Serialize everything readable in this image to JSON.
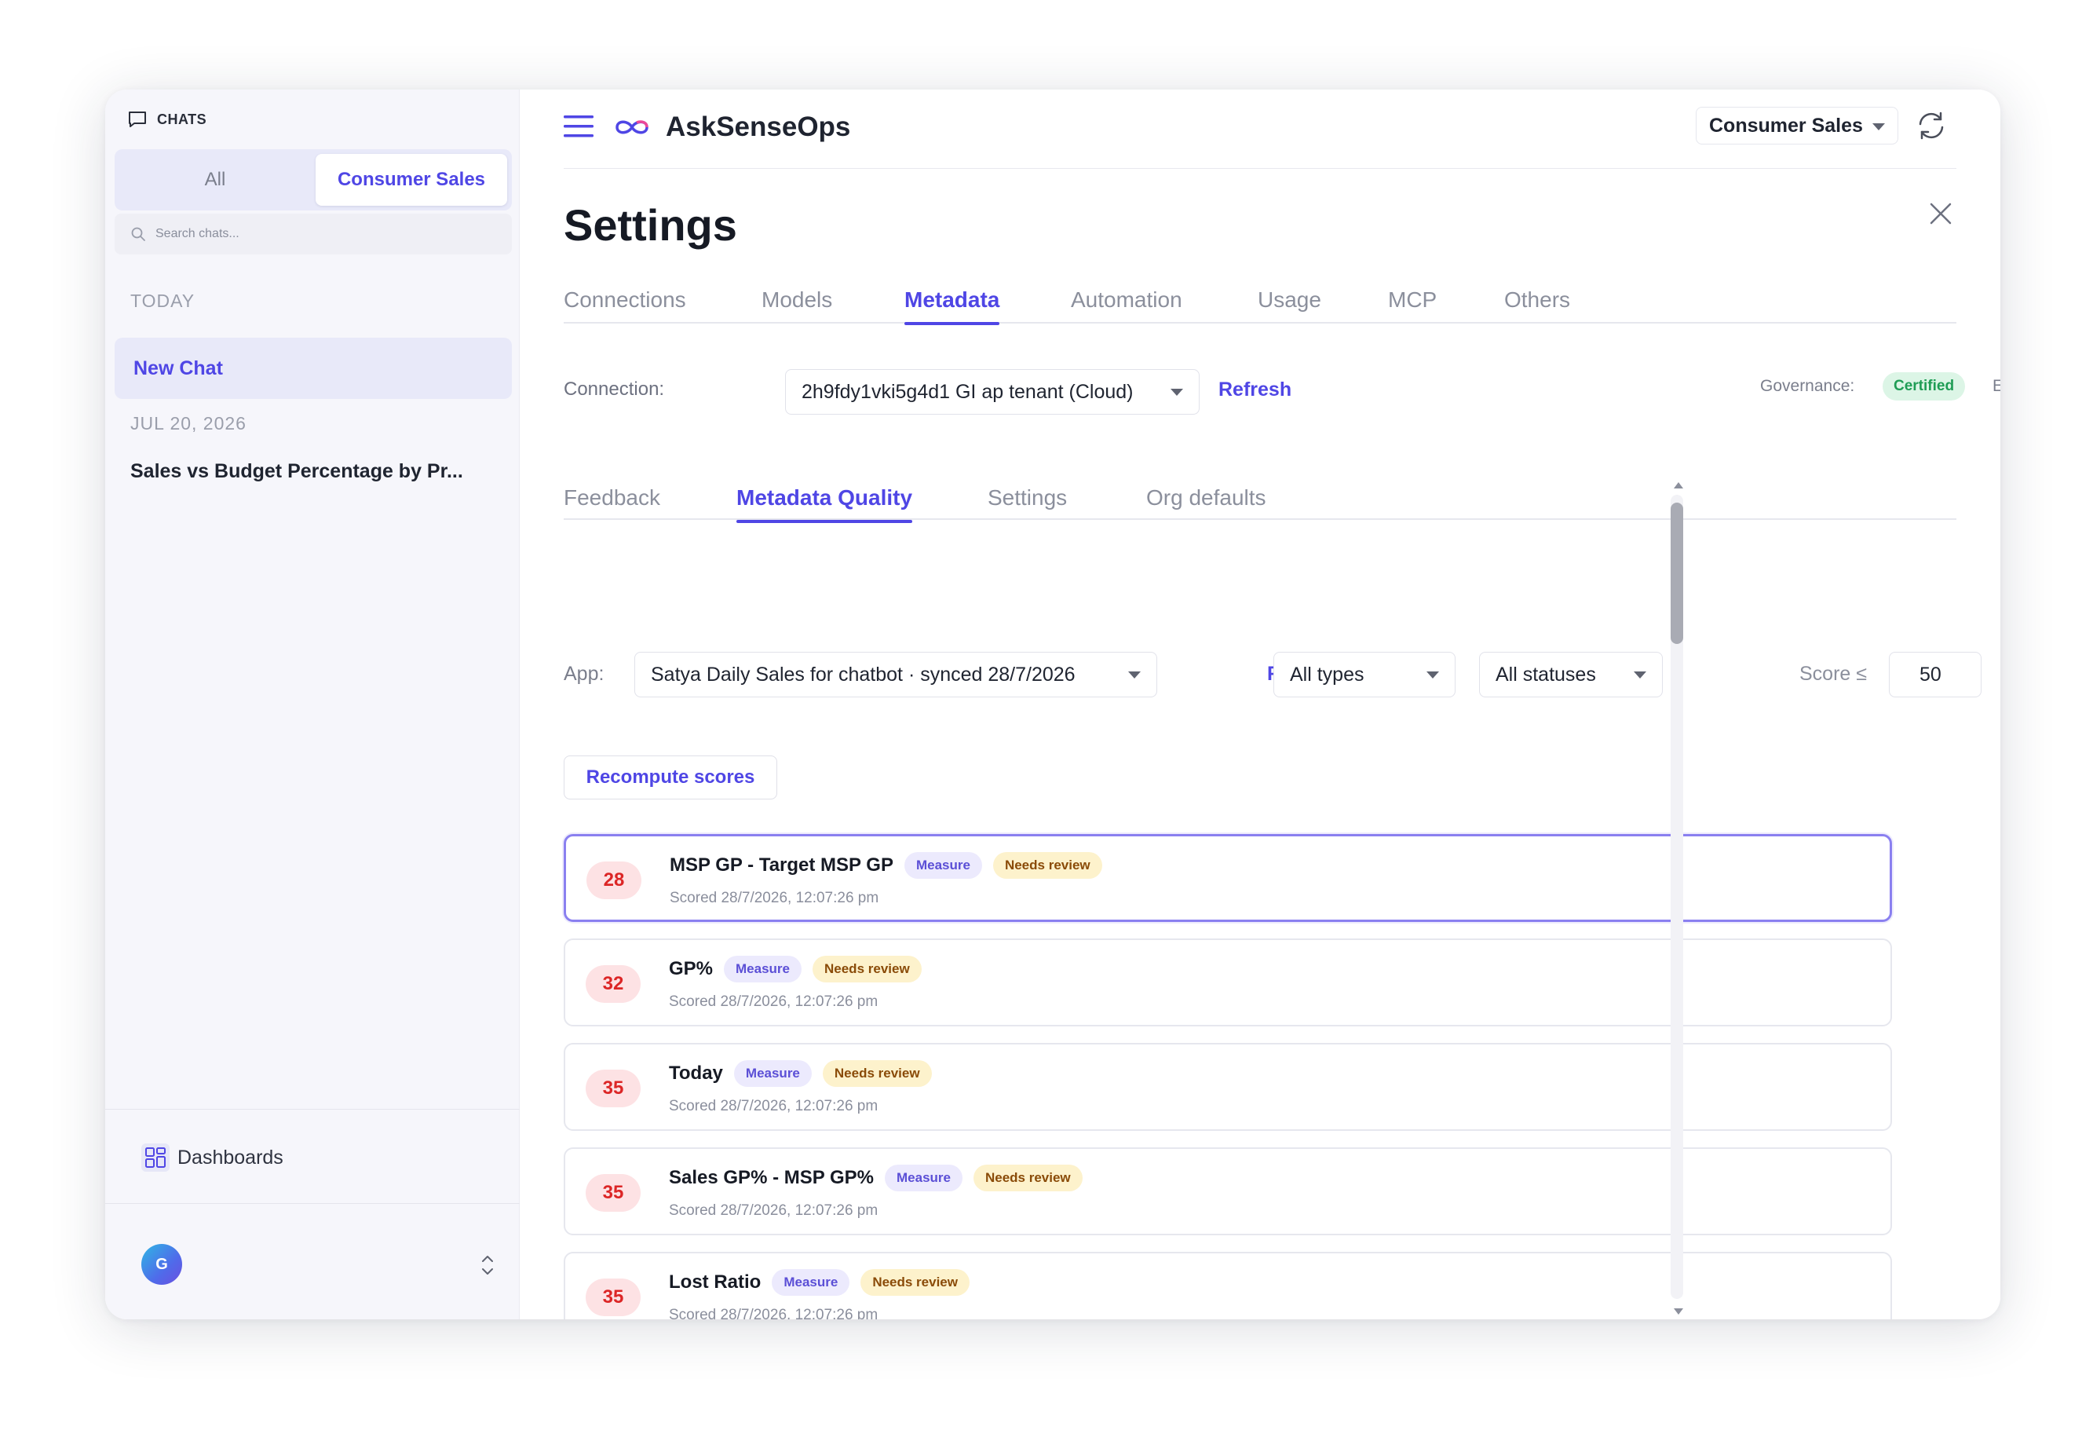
{
  "sidebar": {
    "chats_label": "CHATS",
    "segments": [
      "All",
      "Consumer Sales"
    ],
    "active_segment": "Consumer Sales",
    "search_placeholder": "Search chats...",
    "groups": [
      {
        "label": "TODAY",
        "items": [
          "New Chat"
        ]
      },
      {
        "label": "JUL 20, 2026",
        "items": [
          "Sales vs Budget Percentage by Pr..."
        ]
      }
    ],
    "dashboards_label": "Dashboards",
    "avatar_initial": "G"
  },
  "header": {
    "app_title": "AskSenseOps",
    "workspace": "Consumer Sales",
    "icons": [
      "hamburger-icon",
      "infinity-logo-icon",
      "sync-icon",
      "close-icon"
    ]
  },
  "settings": {
    "title": "Settings",
    "tabs": [
      "Connections",
      "Models",
      "Metadata",
      "Automation",
      "Usage",
      "MCP",
      "Others"
    ],
    "active_tab": "Metadata",
    "connection_label": "Connection:",
    "connection_value": "2h9fdy1vki5g4d1 GI ap tenant (Cloud)",
    "refresh_label": "Refresh",
    "governance_label": "Governance:",
    "governance_badge": "Certified",
    "governance_status": "Enabled",
    "sub_tabs": [
      "Feedback",
      "Metadata Quality",
      "Settings",
      "Org defaults"
    ],
    "active_sub_tab": "Metadata Quality",
    "app_label": "App:",
    "app_value": "Satya Daily Sales for chatbot · synced 28/7/2026",
    "type_filter": "All types",
    "status_filter": "All statuses",
    "score_label": "Score ≤",
    "score_value": "50",
    "recompute_label": "Recompute scores"
  },
  "items": [
    {
      "score": "28",
      "title": "MSP GP - Target MSP GP",
      "type": "Measure",
      "status": "Needs review",
      "scored": "Scored 28/7/2026, 12:07:26 pm"
    },
    {
      "score": "32",
      "title": "GP%",
      "type": "Measure",
      "status": "Needs review",
      "scored": "Scored 28/7/2026, 12:07:26 pm"
    },
    {
      "score": "35",
      "title": "Today",
      "type": "Measure",
      "status": "Needs review",
      "scored": "Scored 28/7/2026, 12:07:26 pm"
    },
    {
      "score": "35",
      "title": "Sales GP% - MSP GP%",
      "type": "Measure",
      "status": "Needs review",
      "scored": "Scored 28/7/2026, 12:07:26 pm"
    },
    {
      "score": "35",
      "title": "Lost Ratio",
      "type": "Measure",
      "status": "Needs review",
      "scored": "Scored 28/7/2026, 12:07:26 pm"
    }
  ],
  "colors": {
    "accent": "#4f46e5",
    "score_low_bg": "#fde2e4",
    "score_low_fg": "#dc2626",
    "certified_bg": "#dcf5e6",
    "certified_fg": "#1f9d55",
    "review_bg": "#fdf2cc",
    "review_fg": "#8a4b08"
  }
}
